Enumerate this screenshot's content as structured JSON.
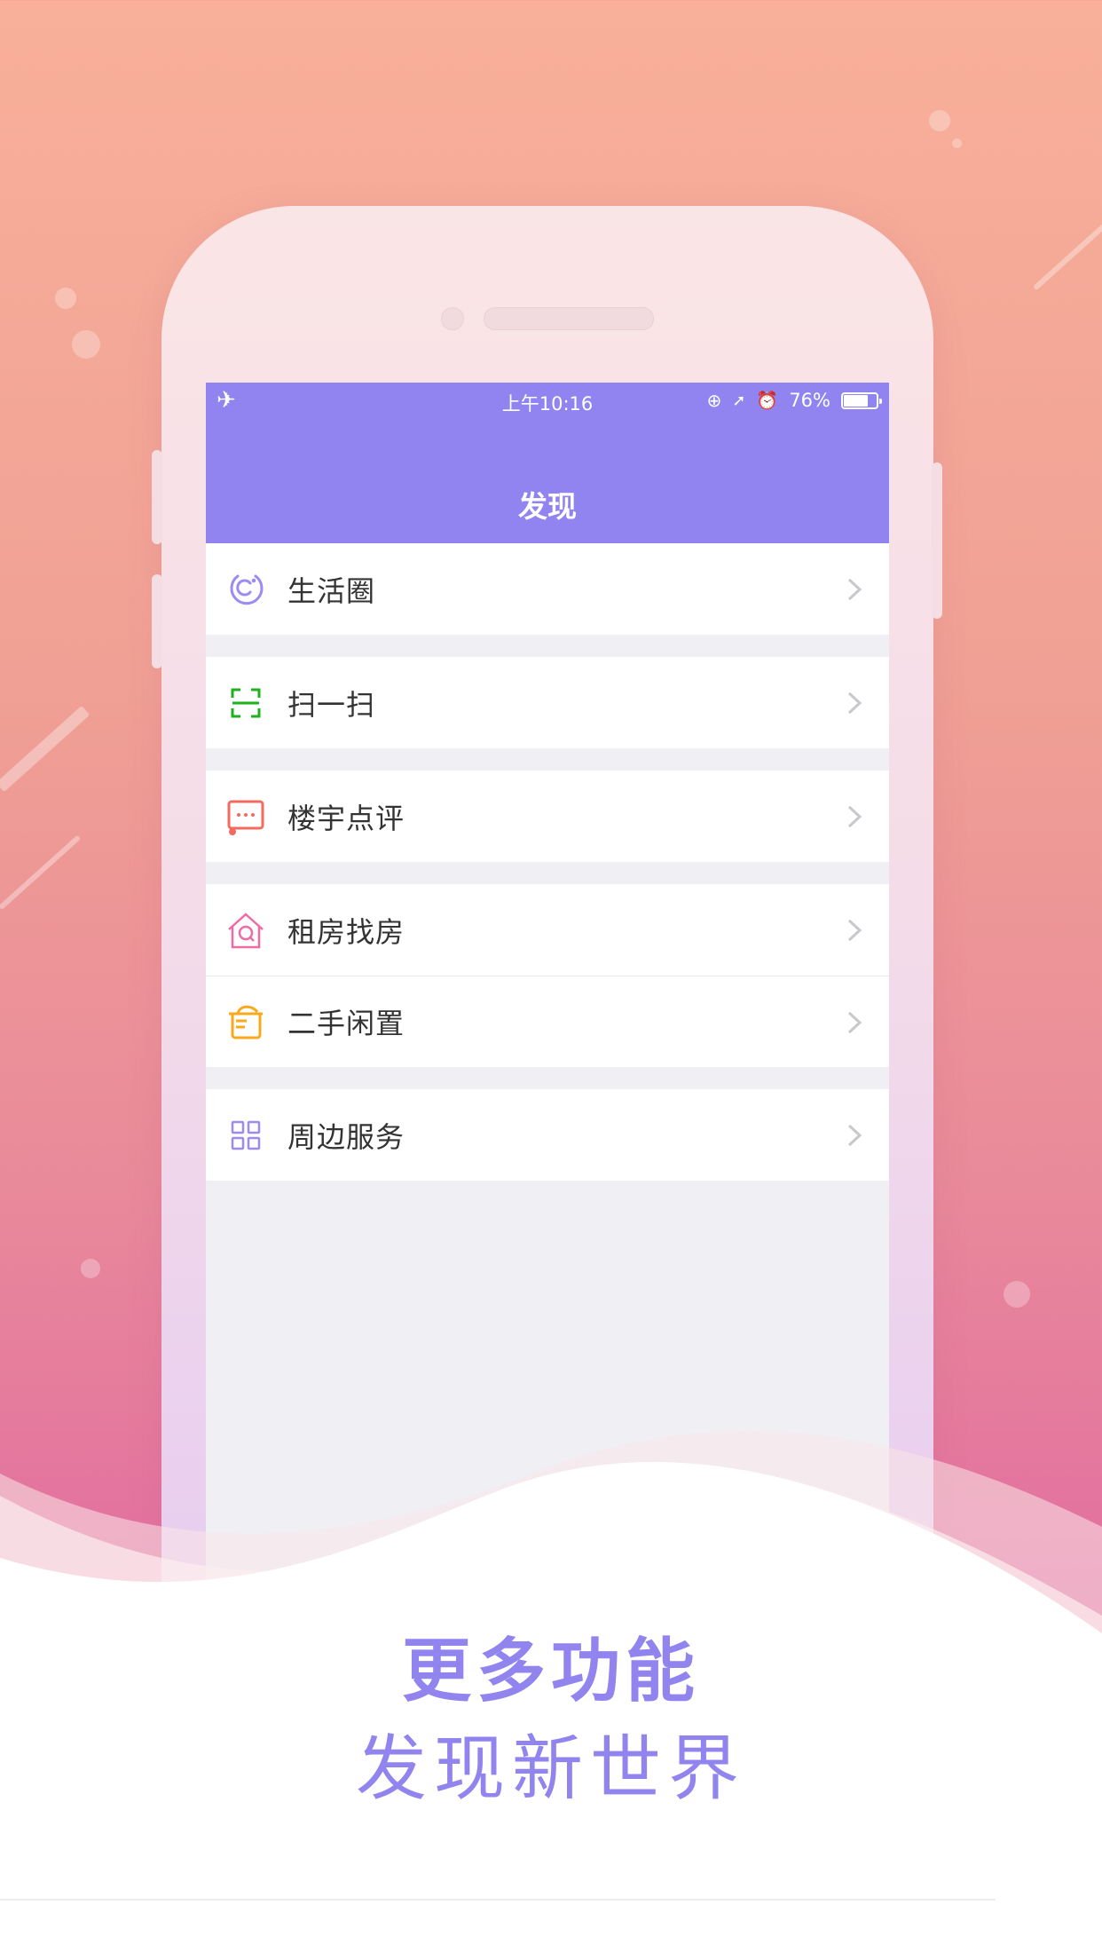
{
  "status_bar": {
    "left_icon": "airplane-icon",
    "time": "上午10:16",
    "icons": [
      "orientation-lock-icon",
      "location-arrow-icon",
      "alarm-icon"
    ],
    "battery_percent_label": "76%",
    "battery_level": 0.76
  },
  "nav": {
    "title": "发现"
  },
  "menu": {
    "groups": [
      [
        {
          "label": "生活圈",
          "icon": "life-circle-icon",
          "color": "#9b8cf2"
        }
      ],
      [
        {
          "label": "扫一扫",
          "icon": "scan-icon",
          "color": "#1db11d"
        }
      ],
      [
        {
          "label": "楼宇点评",
          "icon": "chat-bubble-icon",
          "color": "#f36a5e"
        }
      ],
      [
        {
          "label": "租房找房",
          "icon": "house-search-icon",
          "color": "#f06aa6"
        },
        {
          "label": "二手闲置",
          "icon": "basket-icon",
          "color": "#f9a91b"
        }
      ],
      [
        {
          "label": "周边服务",
          "icon": "grid-icon",
          "color": "#9b8cf2"
        }
      ]
    ]
  },
  "caption": {
    "headline": "更多功能",
    "subline": "发现新世界",
    "color": "#9284ee"
  }
}
